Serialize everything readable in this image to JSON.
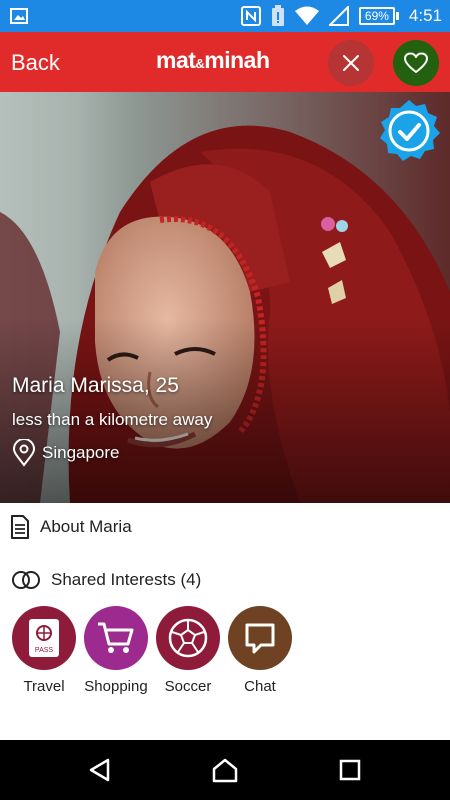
{
  "status_bar": {
    "battery": "69%",
    "time": "4:51",
    "icons": [
      "image-icon",
      "nfc-icon",
      "battery-saver-icon",
      "wifi-icon",
      "signal-icon"
    ]
  },
  "app_bar": {
    "back_label": "Back",
    "logo_part1": "mat",
    "logo_amp": "&",
    "logo_part2": "minah",
    "reject_icon": "close-icon",
    "like_icon": "heart-icon",
    "colors": {
      "bar": "#e12b2b",
      "reject": "#b63434",
      "like": "#23600f"
    }
  },
  "profile": {
    "name_age": "Maria Marissa, 25",
    "distance": "less than a kilometre away",
    "location": "Singapore",
    "verified_icon": "verified-check-icon"
  },
  "about": {
    "label": "About Maria",
    "icon": "document-icon"
  },
  "shared_interests": {
    "label": "Shared Interests (4)",
    "icon": "interlocking-rings-icon",
    "items": [
      {
        "label": "Travel",
        "icon": "passport-icon",
        "color": "#8e1b3a"
      },
      {
        "label": "Shopping",
        "icon": "shopping-cart-icon",
        "color": "#9c2a8f"
      },
      {
        "label": "Soccer",
        "icon": "soccer-ball-icon",
        "color": "#8e1b3a"
      },
      {
        "label": "Chat",
        "icon": "chat-bubble-icon",
        "color": "#6e4222"
      }
    ]
  },
  "nav_bar": {
    "icons": [
      "back-triangle-icon",
      "home-icon",
      "recents-square-icon"
    ]
  }
}
